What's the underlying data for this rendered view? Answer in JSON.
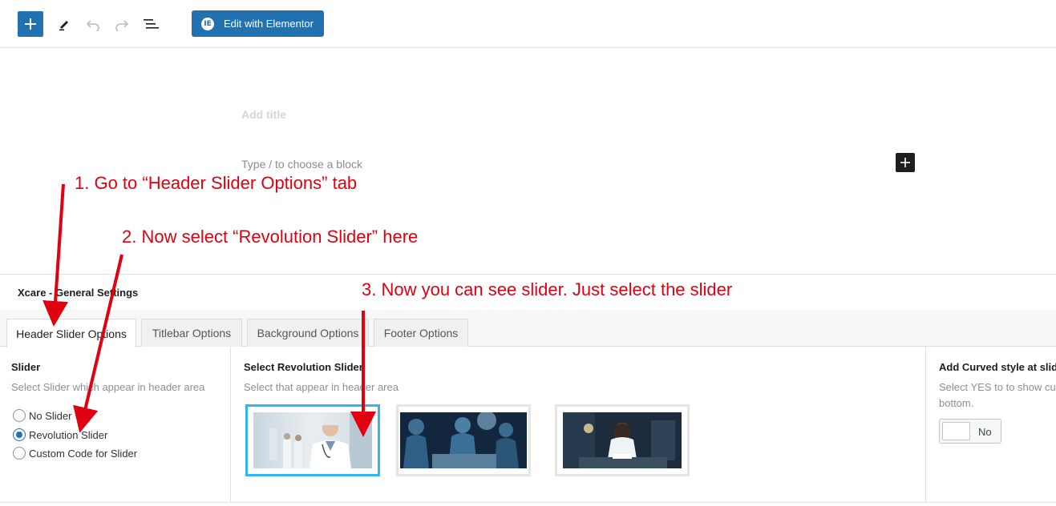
{
  "toolbar": {
    "edit_elementor_label": "Edit with Elementor",
    "elementor_badge": "IE"
  },
  "editor": {
    "title_placeholder": "Add title",
    "block_placeholder": "Type / to choose a block"
  },
  "metabox": {
    "title": "Xcare - General Settings",
    "tabs": [
      {
        "label": "Header Slider Options",
        "active": true
      },
      {
        "label": "Titlebar Options",
        "active": false
      },
      {
        "label": "Background Options",
        "active": false
      },
      {
        "label": "Footer Options",
        "active": false
      }
    ],
    "slider": {
      "label": "Slider",
      "description": "Select Slider which appear in header area",
      "options": [
        {
          "label": "No Slider",
          "checked": false
        },
        {
          "label": "Revolution Slider",
          "checked": true
        },
        {
          "label": "Custom Code for Slider",
          "checked": false
        }
      ]
    },
    "revolution": {
      "label": "Select Revolution Slider",
      "description": "Select that appear in header area",
      "thumbnails": [
        {
          "name": "doctor-portrait",
          "selected": true
        },
        {
          "name": "surgery-team",
          "selected": false
        },
        {
          "name": "doctor-writing",
          "selected": false
        }
      ]
    },
    "curved": {
      "label": "Add Curved style at slider",
      "description_line1": "Select YES to to show curved",
      "description_line2": "bottom.",
      "toggle_label": "No"
    }
  },
  "annotations": {
    "step1": "1. Go to “Header Slider Options” tab",
    "step2": "2. Now select “Revolution Slider” here",
    "step3": "3. Now you can see slider. Just select the slider"
  },
  "colors": {
    "accent": "#2271b1",
    "annotation": "#e0000f",
    "selected_thumb": "#33b5f4"
  }
}
